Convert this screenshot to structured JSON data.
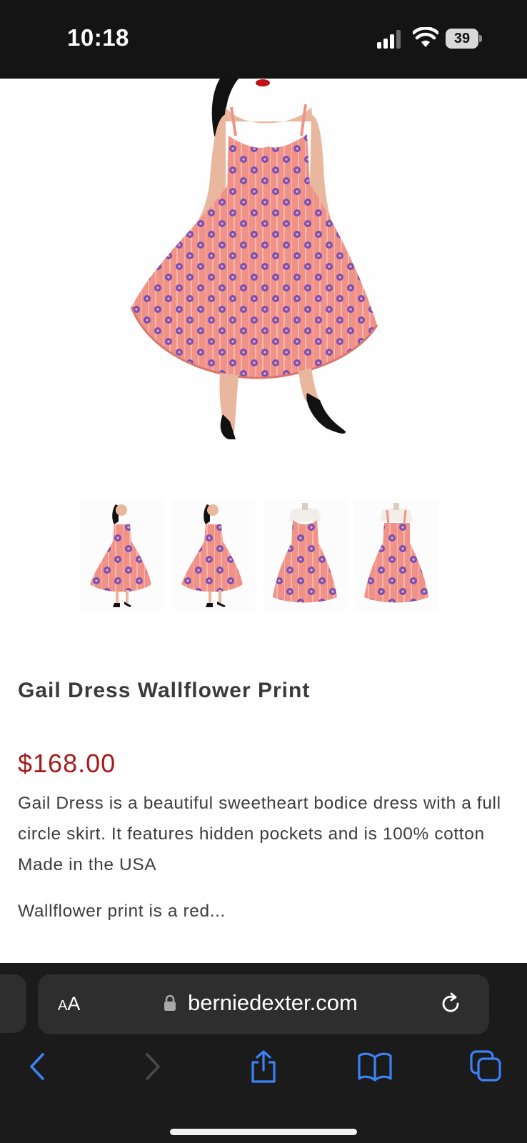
{
  "status_bar": {
    "time": "10:18",
    "battery": "39"
  },
  "product": {
    "title": "Gail Dress Wallflower Print",
    "price": "$168.00",
    "description": "Gail Dress is a beautiful sweetheart bodice dress with a full circle skirt. It features hidden pockets and is 100% cotton Made in the USA",
    "description_more": "Wallflower print is a red..."
  },
  "browser": {
    "text_size_big": "A",
    "text_size_small": "A",
    "url": "berniedexter.com"
  },
  "colors": {
    "price": "#a81a1a",
    "accent": "#3a82f7",
    "dress": "#ef8e86",
    "flower": "#7a4fb5"
  }
}
